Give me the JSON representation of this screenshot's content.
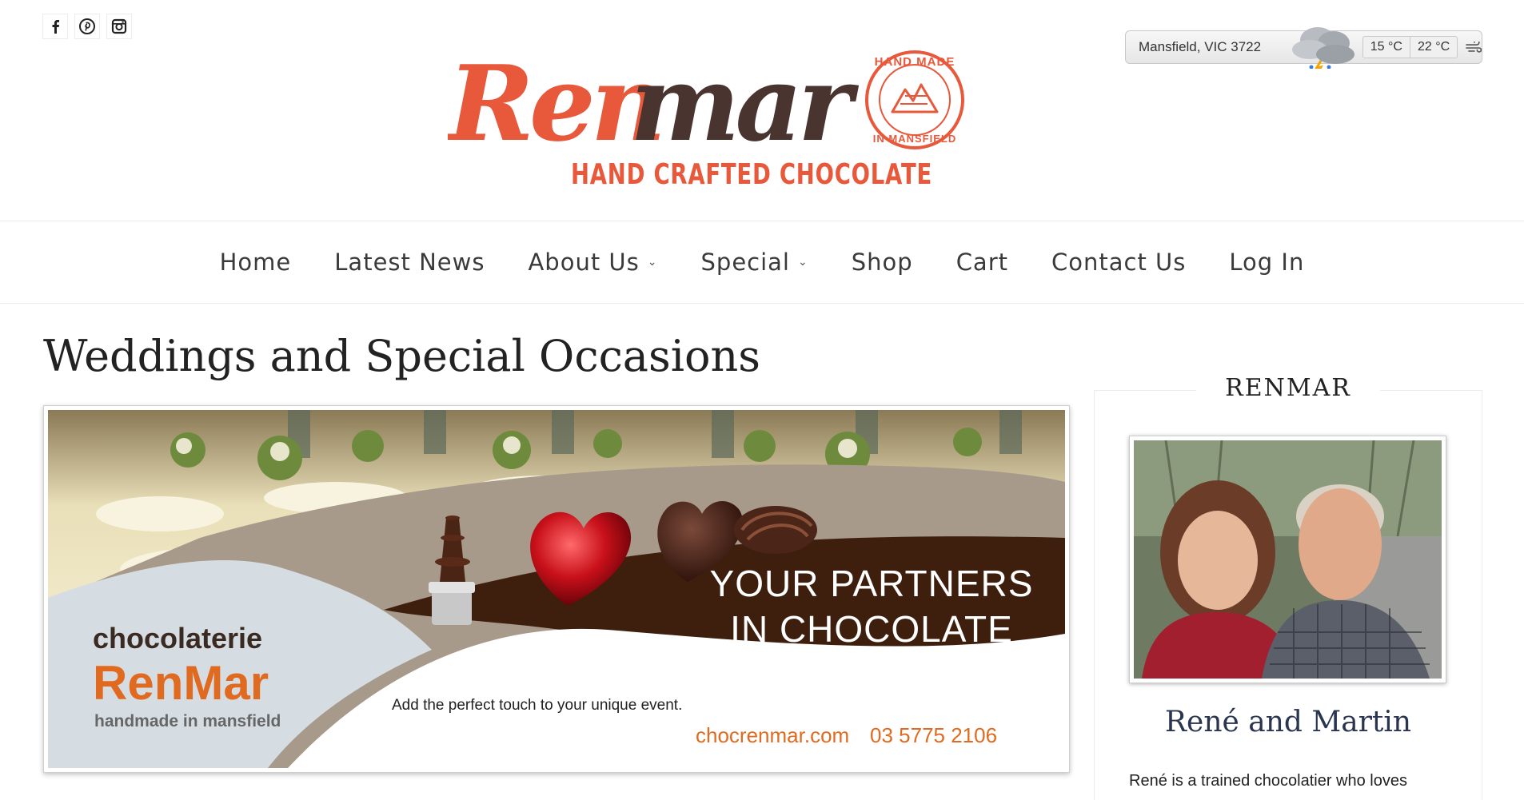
{
  "social": {
    "icons": [
      "facebook-icon",
      "pinterest-icon",
      "instagram-icon"
    ]
  },
  "logo": {
    "brand_part1": "Ren",
    "brand_part2": "mar",
    "tagline": "HAND CRAFTED CHOCOLATE",
    "stamp_top": "HAND MADE",
    "stamp_bottom": "IN MANSFIELD"
  },
  "weather": {
    "location": "Mansfield, VIC 3722",
    "min_temp": "15 °C",
    "max_temp": "22 °C",
    "condition_icon": "storm-cloud-icon"
  },
  "nav": {
    "items": [
      {
        "label": "Home"
      },
      {
        "label": "Latest News"
      },
      {
        "label": "About Us"
      },
      {
        "label": "Special"
      },
      {
        "label": "Shop"
      },
      {
        "label": "Cart"
      },
      {
        "label": "Contact Us"
      },
      {
        "label": "Log In"
      }
    ]
  },
  "main": {
    "title": "Weddings and Special Occasions",
    "banner": {
      "headline_line1": "YOUR PARTNERS",
      "headline_line2": "IN CHOCOLATE",
      "brand_small": "chocolaterie",
      "brand_big": "RenMar",
      "brand_sub": "handmade in mansfield",
      "tagline": "Add the perfect touch to your unique event.",
      "website": "chocrenmar.com",
      "phone": "03 5775 2106"
    }
  },
  "sidebar": {
    "widget_title": "RENMAR",
    "name": "René and Martin",
    "bio_start": "René is a trained chocolatier who loves"
  },
  "colors": {
    "brand_orange": "#e8593c",
    "brand_brown": "#4a3430",
    "banner_dark_brown": "#3e1f0e",
    "banner_taupe": "#a89a8a",
    "banner_blue_gray": "#d5dde3",
    "banner_orange": "#e06a1f"
  }
}
